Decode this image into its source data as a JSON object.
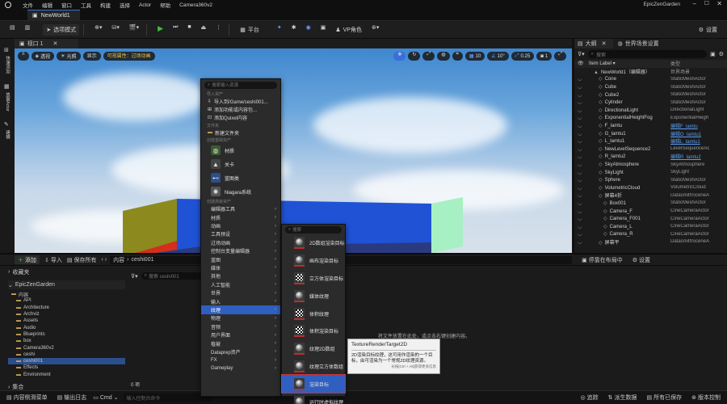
{
  "menubar": {
    "items": [
      "文件",
      "编辑",
      "窗口",
      "工具",
      "构建",
      "选择",
      "Actor",
      "帮助",
      "Camera360v2"
    ],
    "project": "EpicZenGarden"
  },
  "doc_tab": {
    "label": "NewWorld1"
  },
  "toolbar": {
    "mode_label": "选项模式",
    "platform_label": "平台",
    "vp_label": "VP角色",
    "settings_label": "设置"
  },
  "viewport": {
    "tab_label": "视口 1",
    "perspective_label": "透视",
    "lit_label": "光照",
    "show_label": "显示",
    "warning": "可视属性：过场动画",
    "grid_value": "10",
    "rot_value": "10°",
    "scale_value": "0.25",
    "speed_value": "1"
  },
  "left_strip": {
    "labels": [
      "快速添加",
      "放置Actor",
      "建模"
    ]
  },
  "outliner": {
    "tab_label": "大纲",
    "world_tab_label": "世界场景设置",
    "search_placeholder": "搜索",
    "col_label": "Item Label ▾",
    "col_type": "类型",
    "rows": [
      {
        "name": "NewWorld1（编辑器）",
        "type": "世界场景",
        "indent": 1,
        "link": false
      },
      {
        "name": "Cone",
        "type": "StaticMeshActor",
        "indent": 2,
        "link": false
      },
      {
        "name": "Cube",
        "type": "StaticMeshActor",
        "indent": 2,
        "link": false
      },
      {
        "name": "Cube2",
        "type": "StaticMeshActor",
        "indent": 2,
        "link": false
      },
      {
        "name": "Cylinder",
        "type": "StaticMeshActor",
        "indent": 2,
        "link": false
      },
      {
        "name": "DirectionalLight",
        "type": "DirectionalLight",
        "indent": 2,
        "link": false
      },
      {
        "name": "ExponentialHeightFog",
        "type": "ExponentialHeigh",
        "indent": 2,
        "link": false
      },
      {
        "name": "F_lamtu",
        "type": "编辑F_lamtu",
        "indent": 2,
        "link": true
      },
      {
        "name": "G_lamtu1",
        "type": "编辑G_lamtu1",
        "indent": 2,
        "link": true
      },
      {
        "name": "L_lamtu1",
        "type": "编辑L_lamtu1",
        "indent": 2,
        "link": true
      },
      {
        "name": "NewLevelSequence2",
        "type": "LevelSequenceAc",
        "indent": 2,
        "link": false
      },
      {
        "name": "R_lamtu2",
        "type": "编辑R_lamtu2",
        "indent": 2,
        "link": true
      },
      {
        "name": "SkyAtmosphere",
        "type": "SkyAtmosphere",
        "indent": 2,
        "link": false
      },
      {
        "name": "SkyLight",
        "type": "SkyLight",
        "indent": 2,
        "link": false
      },
      {
        "name": "Sphere",
        "type": "StaticMeshActor",
        "indent": 2,
        "link": false
      },
      {
        "name": "VolumetricCloud",
        "type": "VolumetricCloud",
        "indent": 2,
        "link": false
      },
      {
        "name": "屏幕4折",
        "type": "DatasmithSceneA",
        "indent": 2,
        "link": false
      },
      {
        "name": "Box001",
        "type": "StaticMeshActor",
        "indent": 3,
        "link": false
      },
      {
        "name": "Camera_F",
        "type": "CineCameraActor",
        "indent": 3,
        "link": false
      },
      {
        "name": "Camera_F001",
        "type": "CineCameraActor",
        "indent": 3,
        "link": false
      },
      {
        "name": "Camera_L",
        "type": "CineCameraActor",
        "indent": 3,
        "link": false
      },
      {
        "name": "Camera_R",
        "type": "CineCameraActor",
        "indent": 3,
        "link": false
      },
      {
        "name": "屏幕平",
        "type": "DatasmithSceneA",
        "indent": 2,
        "link": false
      }
    ]
  },
  "content_browser": {
    "add_label": "添加",
    "import_label": "导入",
    "save_all_label": "保存所有",
    "crumb_content": "内容",
    "crumb_folder": "ceshi001",
    "favorites_label": "收藏夹",
    "project_label": "EpicZenGarden",
    "search_placeholder": "搜索 ceshi001",
    "dock_label": "停靠在布局中",
    "settings_label": "设置",
    "empty_hint": "将文件放置在此处，或点击右键创建内容。",
    "item_count": "0 项",
    "collections_label": "集合",
    "folders": [
      "内容",
      "API",
      "Architecture",
      "Archviz",
      "Assets",
      "Audio",
      "Blueprints",
      "box",
      "Camera360v2",
      "ceshi",
      "ceshi001",
      "Effects",
      "Environment"
    ]
  },
  "statusbar": {
    "drawer": "内容侧滑菜单",
    "output_log": "输出日志",
    "cmd": "Cmd",
    "cmd_placeholder": "输入控制台命令",
    "trace": "追踪",
    "derived": "派生数据",
    "unsaved": "所有已保存",
    "source_control": "版本控制"
  },
  "context_menu": {
    "search_placeholder": "搜索输入资源",
    "sec_import": "导入资产",
    "import_path": "导入到/Game/ceshi001...",
    "add_feature": "添加功能或内容包...",
    "add_quixel": "添加Quixel内容",
    "sec_folder": "文件夹",
    "new_folder": "新建文件夹",
    "sec_common": "创建基础资产",
    "material": "材质",
    "level": "关卡",
    "blueprint": "蓝图类",
    "niagara": "Niagara系统",
    "sec_advanced": "创建高级资产",
    "categories": [
      "编辑器工具",
      "材质",
      "动画",
      "工具预设",
      "过场动画",
      "控制台变量编辑器",
      "蓝图",
      "媒体",
      "其他",
      "人工智能",
      "世界",
      "输入",
      "纹理",
      "物理",
      "音频",
      "用户界面",
      "植被",
      "Dataprep资产",
      "FX",
      "Gameplay"
    ],
    "selected_category": "纹理"
  },
  "submenu": {
    "search_placeholder": "搜索",
    "items": [
      "2D数组渲染目标",
      "画布渲染目标",
      "立方体渲染目标",
      "媒体纹理",
      "体积纹理",
      "体积渲染目标",
      "纹理2D数组",
      "纹理立方体数组",
      "渲染目标",
      "运行时虚拟纹理"
    ],
    "selected": "渲染目标"
  },
  "tooltip": {
    "title": "TextureRenderTarget2D",
    "body": "2D渲染目标纹理，这可用作渲染的一个目标，由可渲染为一个常规2D纹理资源。",
    "hint": "长按[Ctrl + Alt]获得更多信息"
  }
}
